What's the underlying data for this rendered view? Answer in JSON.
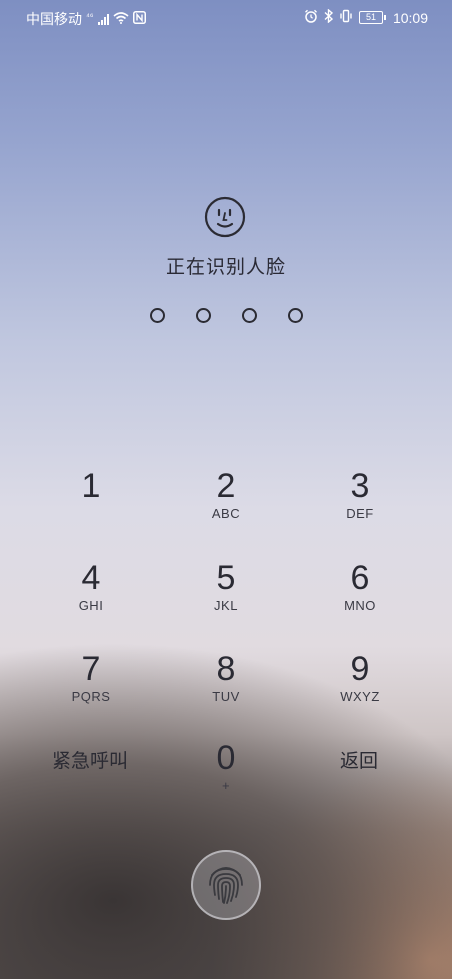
{
  "status_bar": {
    "carrier": "中国移动",
    "network": "⁴⁶",
    "time": "10:09",
    "battery": "51"
  },
  "lock": {
    "face_status": "正在识别人脸",
    "pin_dots": 4
  },
  "keypad": {
    "keys": [
      {
        "num": "1",
        "letters": ""
      },
      {
        "num": "2",
        "letters": "ABC"
      },
      {
        "num": "3",
        "letters": "DEF"
      },
      {
        "num": "4",
        "letters": "GHI"
      },
      {
        "num": "5",
        "letters": "JKL"
      },
      {
        "num": "6",
        "letters": "MNO"
      },
      {
        "num": "7",
        "letters": "PQRS"
      },
      {
        "num": "8",
        "letters": "TUV"
      },
      {
        "num": "9",
        "letters": "WXYZ"
      },
      {
        "num": "0",
        "letters": "+"
      }
    ],
    "emergency_label": "紧急呼叫",
    "back_label": "返回"
  }
}
